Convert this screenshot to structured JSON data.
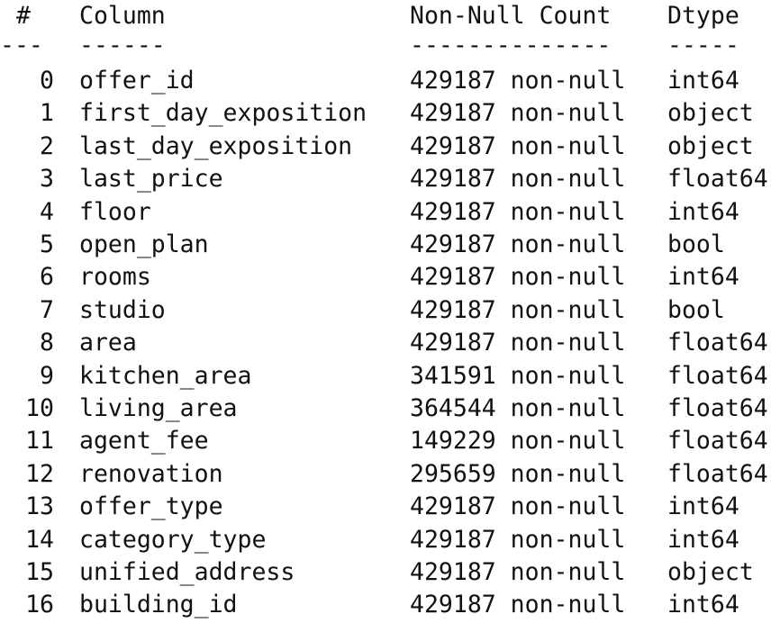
{
  "header": {
    "idx": "#",
    "column": "Column",
    "count": "Non-Null Count",
    "dtype": "Dtype"
  },
  "separator": {
    "idx": "---",
    "column": "------",
    "count": "--------------",
    "dtype": "-----"
  },
  "rows": [
    {
      "idx": "0",
      "column": "offer_id",
      "count": "429187 non-null",
      "dtype": "int64"
    },
    {
      "idx": "1",
      "column": "first_day_exposition",
      "count": "429187 non-null",
      "dtype": "object"
    },
    {
      "idx": "2",
      "column": "last_day_exposition",
      "count": "429187 non-null",
      "dtype": "object"
    },
    {
      "idx": "3",
      "column": "last_price",
      "count": "429187 non-null",
      "dtype": "float64"
    },
    {
      "idx": "4",
      "column": "floor",
      "count": "429187 non-null",
      "dtype": "int64"
    },
    {
      "idx": "5",
      "column": "open_plan",
      "count": "429187 non-null",
      "dtype": "bool"
    },
    {
      "idx": "6",
      "column": "rooms",
      "count": "429187 non-null",
      "dtype": "int64"
    },
    {
      "idx": "7",
      "column": "studio",
      "count": "429187 non-null",
      "dtype": "bool"
    },
    {
      "idx": "8",
      "column": "area",
      "count": "429187 non-null",
      "dtype": "float64"
    },
    {
      "idx": "9",
      "column": "kitchen_area",
      "count": "341591 non-null",
      "dtype": "float64"
    },
    {
      "idx": "10",
      "column": "living_area",
      "count": "364544 non-null",
      "dtype": "float64"
    },
    {
      "idx": "11",
      "column": "agent_fee",
      "count": "149229 non-null",
      "dtype": "float64"
    },
    {
      "idx": "12",
      "column": "renovation",
      "count": "295659 non-null",
      "dtype": "float64"
    },
    {
      "idx": "13",
      "column": "offer_type",
      "count": "429187 non-null",
      "dtype": "int64"
    },
    {
      "idx": "14",
      "column": "category_type",
      "count": "429187 non-null",
      "dtype": "int64"
    },
    {
      "idx": "15",
      "column": "unified_address",
      "count": "429187 non-null",
      "dtype": "object"
    },
    {
      "idx": "16",
      "column": "building_id",
      "count": "429187 non-null",
      "dtype": "int64"
    }
  ]
}
